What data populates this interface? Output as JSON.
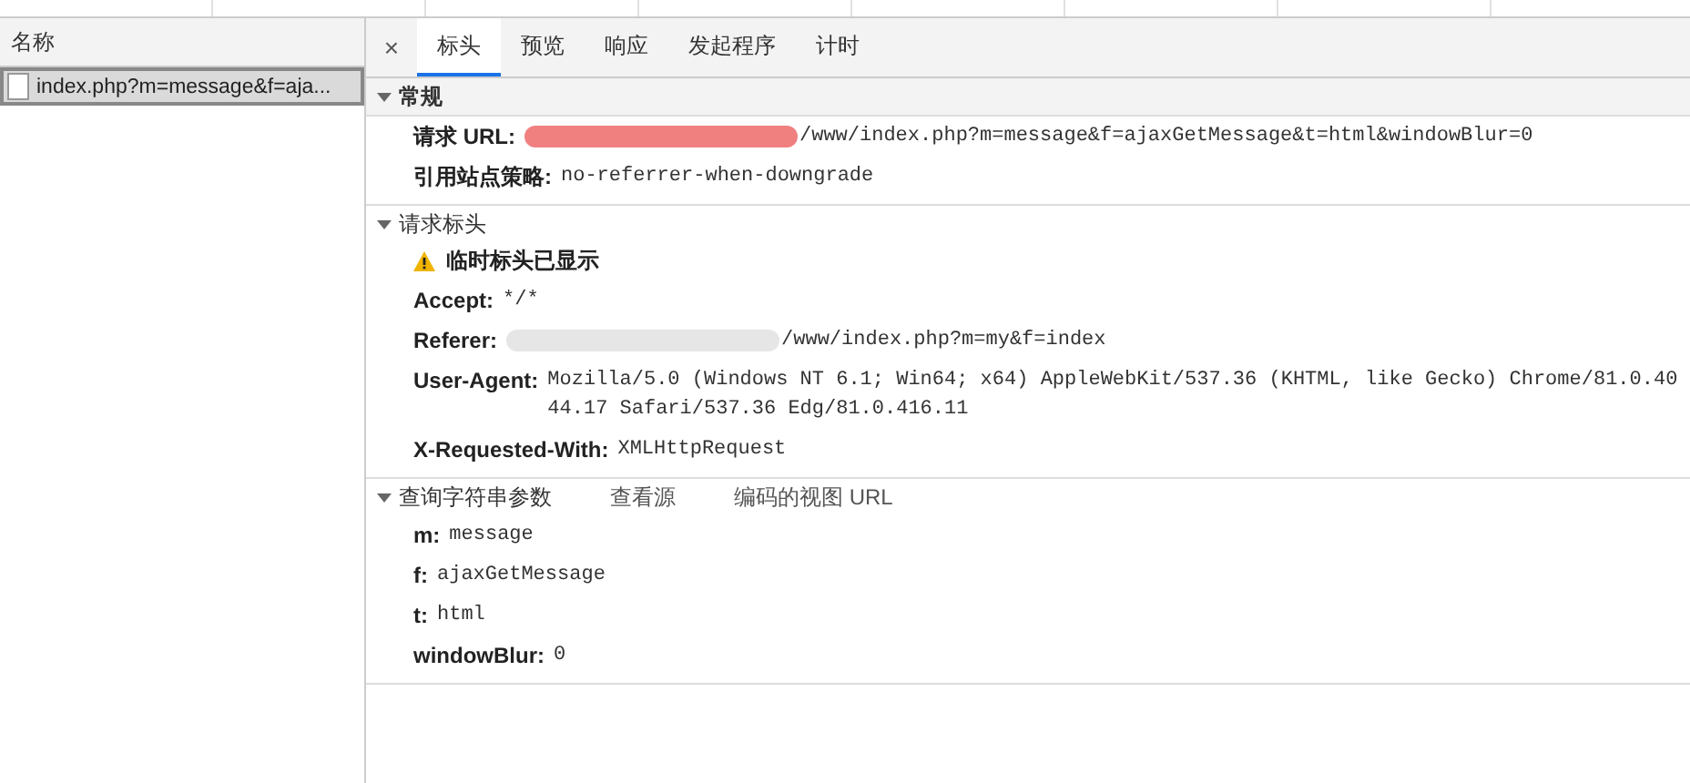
{
  "requests": {
    "column": "名称",
    "items": [
      {
        "name": "index.php?m=message&f=aja...",
        "selected": true
      }
    ]
  },
  "tabs": [
    {
      "label": "标头",
      "selected": true
    },
    {
      "label": "预览",
      "selected": false
    },
    {
      "label": "响应",
      "selected": false
    },
    {
      "label": "发起程序",
      "selected": false
    },
    {
      "label": "计时",
      "selected": false
    }
  ],
  "close": "×",
  "sections": [
    {
      "title": "常规",
      "expanded": true,
      "shaded": true,
      "rows": [
        {
          "key": "请求 URL:",
          "value": "/www/index.php?m=message&f=ajaxGetMessage&t=html&windowBlur=0",
          "redacted": true,
          "color": "#f08080"
        },
        {
          "key": "引用站点策略:",
          "value": "no-referrer-when-downgrade",
          "redacted": false
        }
      ]
    },
    {
      "title": "请求标头",
      "expanded": true,
      "shaded": false,
      "warning": "临时标头已显示",
      "rows": [
        {
          "key": "Accept:",
          "value": "*/*",
          "redacted": false
        },
        {
          "key": "Referer:",
          "value": "/www/index.php?m=my&f=index",
          "redacted": true,
          "color": "#e6e6e6"
        },
        {
          "key": "User-Agent:",
          "value": "Mozilla/5.0 (Windows NT 6.1; Win64; x64) AppleWebKit/537.36 (KHTML, like Gecko) Chrome/81.0.4044.17 Safari/537.36 Edg/81.0.416.11",
          "redacted": false
        },
        {
          "key": "X-Requested-With:",
          "value": "XMLHttpRequest",
          "redacted": false
        }
      ]
    },
    {
      "title": "查询字符串参数",
      "expanded": true,
      "shaded": false,
      "links": [
        "查看源",
        "编码的视图 URL"
      ],
      "rows": [
        {
          "key": "m:",
          "value": "message",
          "redacted": false
        },
        {
          "key": "f:",
          "value": "ajaxGetMessage",
          "redacted": false
        },
        {
          "key": "t:",
          "value": "html",
          "redacted": false
        },
        {
          "key": "windowBlur:",
          "value": "0",
          "redacted": false
        }
      ]
    }
  ]
}
